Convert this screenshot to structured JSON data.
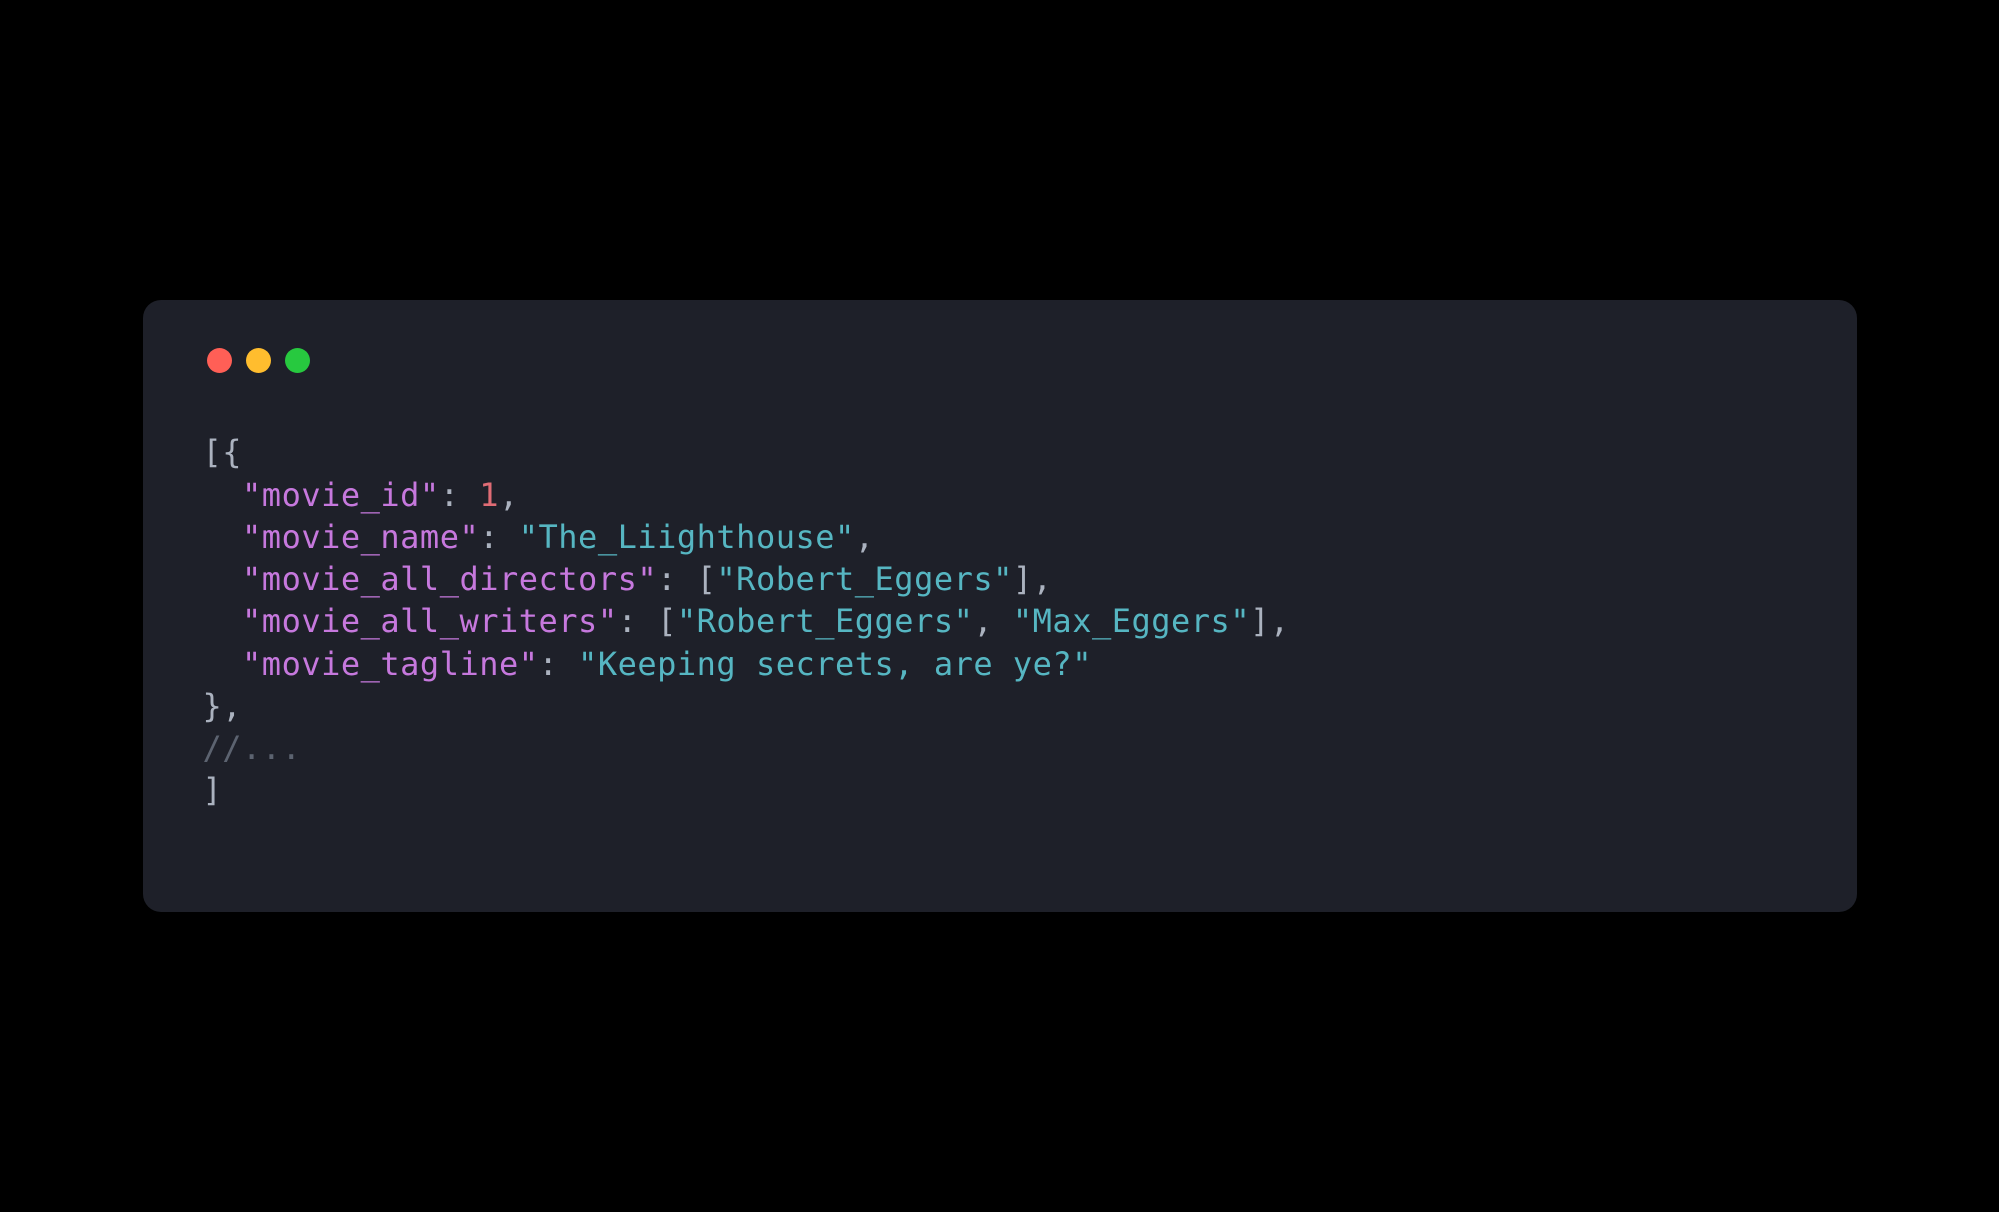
{
  "code": {
    "lines": [
      {
        "indent": 0,
        "tokens": [
          {
            "cls": "tok-punct",
            "text": "[{"
          }
        ]
      },
      {
        "indent": 1,
        "tokens": [
          {
            "cls": "tok-key",
            "text": "\"movie_id\""
          },
          {
            "cls": "tok-punct",
            "text": ": "
          },
          {
            "cls": "tok-number",
            "text": "1"
          },
          {
            "cls": "tok-punct",
            "text": ","
          }
        ]
      },
      {
        "indent": 1,
        "tokens": [
          {
            "cls": "tok-key",
            "text": "\"movie_name\""
          },
          {
            "cls": "tok-punct",
            "text": ": "
          },
          {
            "cls": "tok-string",
            "text": "\"The_Liighthouse\""
          },
          {
            "cls": "tok-punct",
            "text": ","
          }
        ]
      },
      {
        "indent": 1,
        "tokens": [
          {
            "cls": "tok-key",
            "text": "\"movie_all_directors\""
          },
          {
            "cls": "tok-punct",
            "text": ": ["
          },
          {
            "cls": "tok-string",
            "text": "\"Robert_Eggers\""
          },
          {
            "cls": "tok-punct",
            "text": "],"
          }
        ]
      },
      {
        "indent": 1,
        "tokens": [
          {
            "cls": "tok-key",
            "text": "\"movie_all_writers\""
          },
          {
            "cls": "tok-punct",
            "text": ": ["
          },
          {
            "cls": "tok-string",
            "text": "\"Robert_Eggers\""
          },
          {
            "cls": "tok-punct",
            "text": ", "
          },
          {
            "cls": "tok-string",
            "text": "\"Max_Eggers\""
          },
          {
            "cls": "tok-punct",
            "text": "],"
          }
        ]
      },
      {
        "indent": 1,
        "tokens": [
          {
            "cls": "tok-key",
            "text": "\"movie_tagline\""
          },
          {
            "cls": "tok-punct",
            "text": ": "
          },
          {
            "cls": "tok-string",
            "text": "\"Keeping secrets, are ye?\""
          }
        ]
      },
      {
        "indent": 0,
        "tokens": [
          {
            "cls": "tok-punct",
            "text": "},"
          }
        ]
      },
      {
        "indent": 0,
        "tokens": [
          {
            "cls": "tok-comment",
            "text": "//..."
          }
        ]
      },
      {
        "indent": 0,
        "tokens": [
          {
            "cls": "tok-punct",
            "text": "]"
          }
        ]
      }
    ]
  },
  "window": {
    "traffic_colors": {
      "red": "#ff5f56",
      "yellow": "#ffbd2e",
      "green": "#27c93f"
    }
  }
}
